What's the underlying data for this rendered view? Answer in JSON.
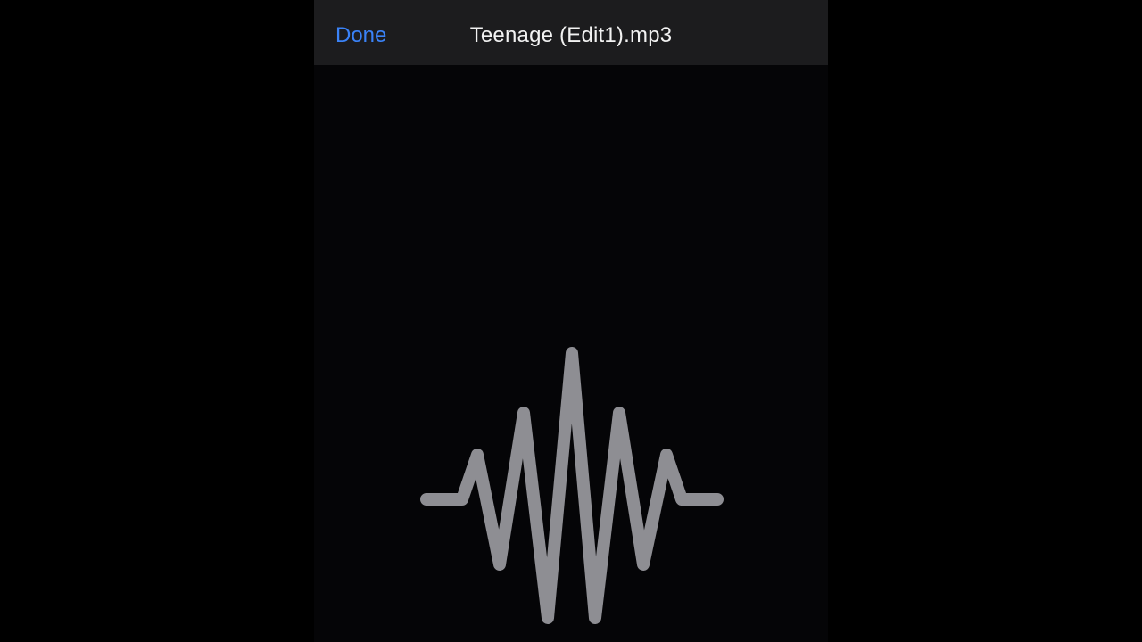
{
  "nav": {
    "done_label": "Done",
    "title": "Teenage (Edit1).mp3"
  },
  "content": {
    "icon": "audio-waveform-icon"
  },
  "colors": {
    "background": "#000000",
    "nav_background": "#1c1c1e",
    "accent": "#3a82f7",
    "title_text": "#f2f2f2",
    "waveform": "#8e8e93"
  }
}
